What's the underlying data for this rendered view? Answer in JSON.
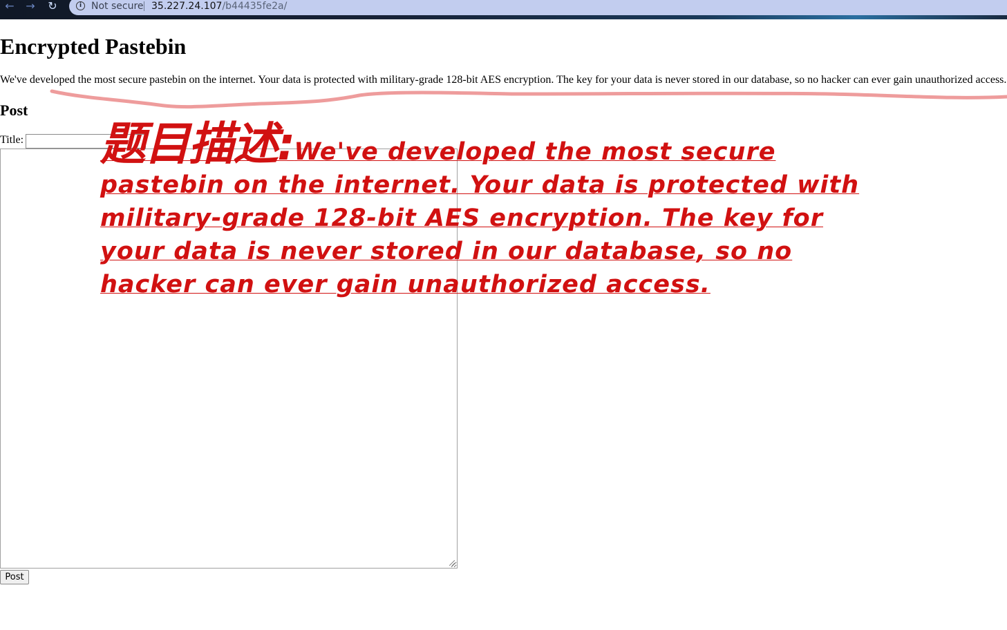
{
  "browser": {
    "back_icon": "←",
    "forward_icon": "→",
    "reload_icon": "↻",
    "security_label": "Not secure",
    "url_host": "35.227.24.107",
    "url_path": "/b44435fe2a/"
  },
  "page": {
    "title": "Encrypted Pastebin",
    "description": "We've developed the most secure pastebin on the internet. Your data is protected with military-grade 128-bit AES encryption. The key for your data is never stored in our database, so no hacker can ever gain unauthorized access.",
    "post_heading": "Post",
    "title_label": "Title:",
    "title_value": "",
    "body_value": "",
    "post_button_label": "Post"
  },
  "annotation": {
    "prefix": "题目描述:",
    "text": "We've developed the most secure pastebin on the internet. Your data is protected with military-grade 128-bit AES encryption. The key for your data is never stored in our database, so no hacker can ever gain unauthorized access.",
    "color": "#d11111"
  },
  "colors": {
    "highlight_stroke": "#e87b7b",
    "url_bar_bg": "#c2cdef"
  }
}
